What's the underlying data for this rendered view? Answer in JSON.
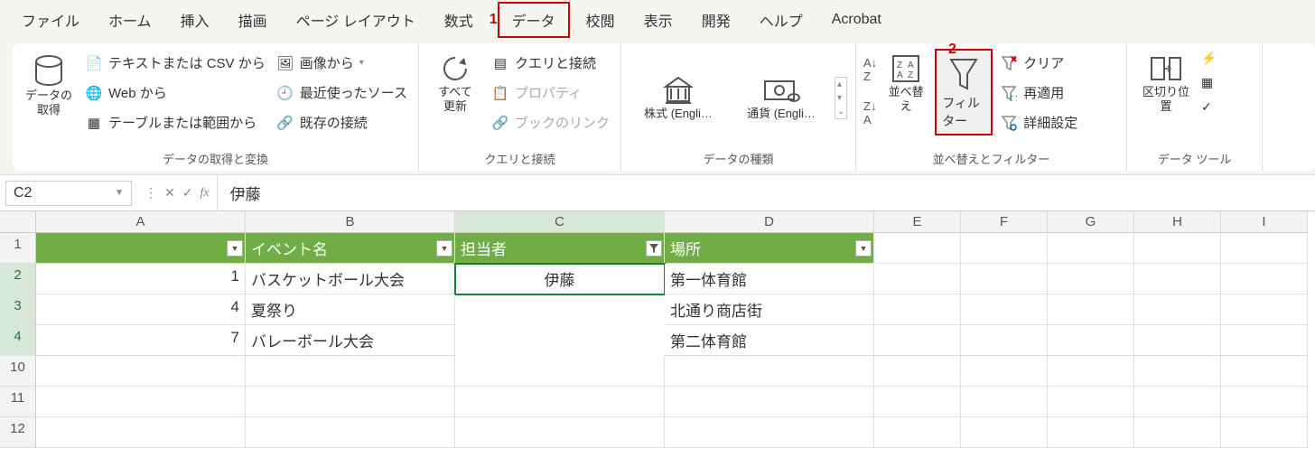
{
  "tabs": {
    "file": "ファイル",
    "home": "ホーム",
    "insert": "挿入",
    "draw": "描画",
    "layout": "ページ レイアウト",
    "formulas": "数式",
    "data": "データ",
    "review": "校閲",
    "view": "表示",
    "developer": "開発",
    "help": "ヘルプ",
    "acrobat": "Acrobat"
  },
  "annotations": {
    "one": "1",
    "two": "2"
  },
  "ribbon": {
    "get_data": {
      "label": "データの\n取得",
      "group": "データの取得と変換"
    },
    "from_csv": "テキストまたは CSV から",
    "from_web": "Web から",
    "from_table": "テーブルまたは範囲から",
    "from_picture": "画像から",
    "recent": "最近使ったソース",
    "existing": "既存の接続",
    "refresh": {
      "label": "すべて\n更新",
      "group": "クエリと接続"
    },
    "queries": "クエリと接続",
    "properties": "プロパティ",
    "book_link": "ブックのリンク",
    "stocks": "株式 (Engli…",
    "currency": "通貨 (Engli…",
    "data_types_group": "データの種類",
    "sort": "並べ替え",
    "sort_filter_group": "並べ替えとフィルター",
    "filter": "フィルター",
    "clear": "クリア",
    "reapply": "再適用",
    "advanced": "詳細設定",
    "text_to_cols": "区切り位置",
    "data_tools_group": "データ ツール"
  },
  "formula_bar": {
    "name_box": "C2",
    "value": "伊藤"
  },
  "columns": [
    "A",
    "B",
    "C",
    "D",
    "E",
    "F",
    "G",
    "H",
    "I"
  ],
  "rows_visible": [
    "1",
    "2",
    "3",
    "4",
    "10",
    "11",
    "12"
  ],
  "table": {
    "headers": {
      "a": "",
      "b": "イベント名",
      "c": "担当者",
      "d": "場所"
    },
    "rows": [
      {
        "n": "1",
        "event": "バスケットボール大会",
        "place": "第一体育館"
      },
      {
        "n": "4",
        "event": "夏祭り",
        "place": "北通り商店街"
      },
      {
        "n": "7",
        "event": "バレーボール大会",
        "place": "第二体育館"
      }
    ],
    "merged_c": "伊藤"
  }
}
